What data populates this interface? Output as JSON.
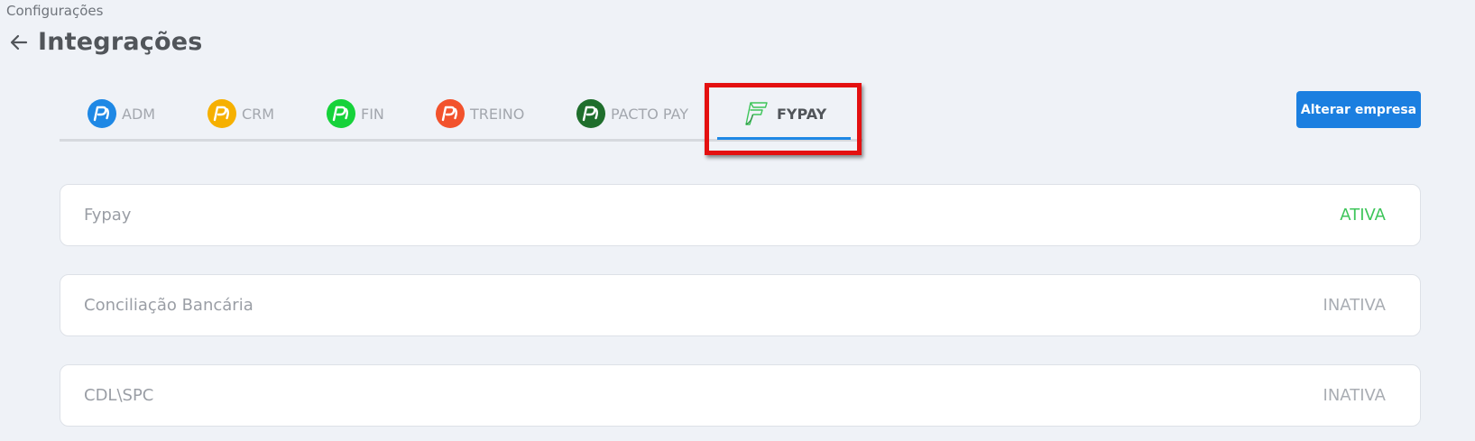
{
  "breadcrumb": "Configurações",
  "header": {
    "title": "Integrações"
  },
  "tabs": [
    {
      "label": "ADM",
      "icon": "pacto-logo-icon",
      "color": "#1e88e5"
    },
    {
      "label": "CRM",
      "icon": "pacto-logo-icon",
      "color": "#f6b000"
    },
    {
      "label": "FIN",
      "icon": "pacto-logo-icon",
      "color": "#16d23a"
    },
    {
      "label": "TREINO",
      "icon": "pacto-logo-icon",
      "color": "#f2522c"
    },
    {
      "label": "PACTO PAY",
      "icon": "pacto-logo-icon",
      "color": "#1f6e2c"
    },
    {
      "label": "FYPAY",
      "icon": "fypay-logo-icon",
      "color": "#3ec55a",
      "active": true
    }
  ],
  "actions": {
    "alterar_empresa": "Alterar empresa"
  },
  "integrations": [
    {
      "name": "Fypay",
      "status": "ATIVA",
      "active": true
    },
    {
      "name": "Conciliação Bancária",
      "status": "INATIVA",
      "active": false
    },
    {
      "name": "CDL\\SPC",
      "status": "INATIVA",
      "active": false
    }
  ],
  "colors": {
    "accent": "#1b7fe0",
    "active_status": "#3ec55a",
    "highlight": "#e41010"
  }
}
